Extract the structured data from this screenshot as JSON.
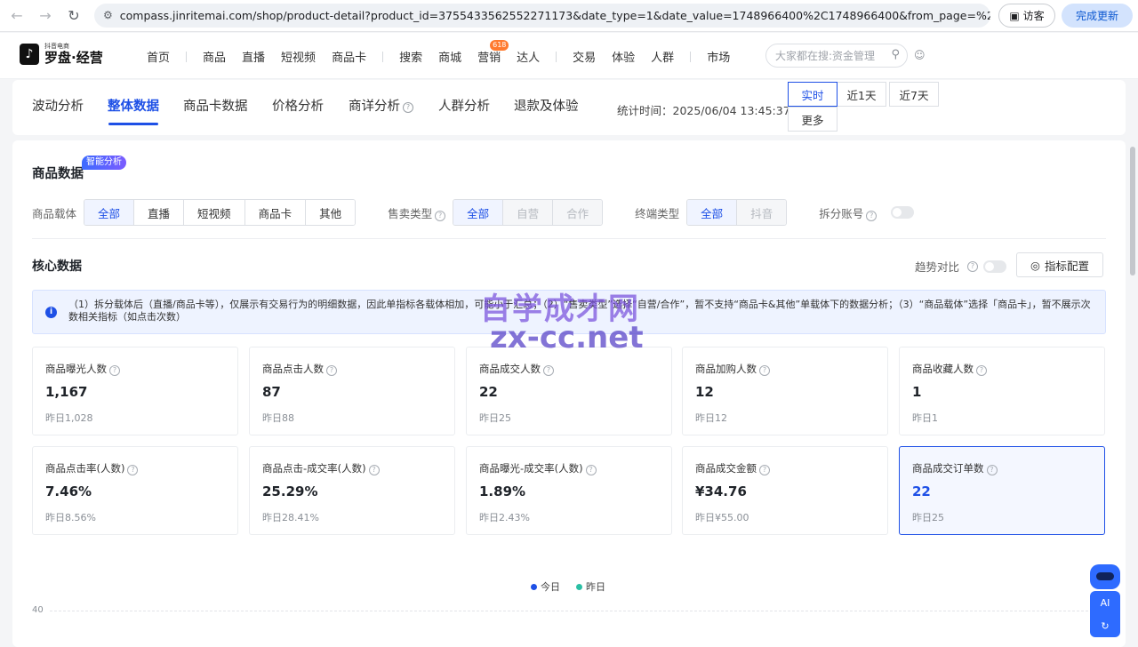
{
  "browser": {
    "url": "compass.jinritemai.com/shop/product-detail?product_id=3755433562552271173&date_type=1&date_value=1748966400%2C1748966400&from_page=%2Fsh...",
    "visitor_label": "访客",
    "update_label": "完成更新"
  },
  "header": {
    "logo_sub": "抖音电商",
    "logo_main": "罗盘·经营",
    "nav": [
      "首页",
      "商品",
      "直播",
      "短视频",
      "商品卡",
      "搜索",
      "商城",
      "营销",
      "达人",
      "交易",
      "体验",
      "人群",
      "市场"
    ],
    "badge": "618",
    "search_placeholder": "大家都在搜:资金管理"
  },
  "tabs": {
    "items": [
      "波动分析",
      "整体数据",
      "商品卡数据",
      "价格分析",
      "商详分析",
      "人群分析",
      "退款及体验"
    ],
    "stat_time": "统计时间：2025/06/04 13:45:37",
    "time_buttons": [
      "实时",
      "近1天",
      "近7天",
      "更多"
    ]
  },
  "product_data": {
    "title": "商品数据",
    "ai_tag": "智能分析",
    "carrier_label": "商品载体",
    "carriers": [
      "全部",
      "直播",
      "短视频",
      "商品卡",
      "其他"
    ],
    "sale_type_label": "售卖类型",
    "sale_types": [
      "全部",
      "自营",
      "合作"
    ],
    "terminal_label": "终端类型",
    "terminals": [
      "全部",
      "抖音"
    ],
    "split_label": "拆分账号"
  },
  "core": {
    "title": "核心数据",
    "trend_label": "趋势对比",
    "config_label": "指标配置",
    "notice": "（1）拆分载体后（直播/商品卡等），仅展示有交易行为的明细数据，因此单指标各载体相加，可能小于汇总；（2）“售卖类型”选择“自营/合作”，暂不支持“商品卡&其他”单载体下的数据分析；（3）“商品载体”选择「商品卡」，暂不展示次数相关指标（如点击次数）",
    "metrics": [
      {
        "name": "商品曝光人数",
        "value": "1,167",
        "yest": "昨日1,028"
      },
      {
        "name": "商品点击人数",
        "value": "87",
        "yest": "昨日88"
      },
      {
        "name": "商品成交人数",
        "value": "22",
        "yest": "昨日25"
      },
      {
        "name": "商品加购人数",
        "value": "12",
        "yest": "昨日12"
      },
      {
        "name": "商品收藏人数",
        "value": "1",
        "yest": "昨日1"
      },
      {
        "name": "商品点击率(人数)",
        "value": "7.46%",
        "yest": "昨日8.56%"
      },
      {
        "name": "商品点击-成交率(人数)",
        "value": "25.29%",
        "yest": "昨日28.41%"
      },
      {
        "name": "商品曝光-成交率(人数)",
        "value": "1.89%",
        "yest": "昨日2.43%"
      },
      {
        "name": "商品成交金额",
        "value": "¥34.76",
        "yest": "昨日¥55.00"
      },
      {
        "name": "商品成交订单数",
        "value": "22",
        "yest": "昨日25"
      }
    ]
  },
  "chart": {
    "legend_today": "今日",
    "legend_yesterday": "昨日",
    "y_tick_top": "40",
    "colors": {
      "today": "#1e50e6",
      "yesterday": "#2bbfa4"
    }
  },
  "watermark": {
    "line1": "自学成才网",
    "line2": "zx-cc.net"
  },
  "bot_label": "AI"
}
